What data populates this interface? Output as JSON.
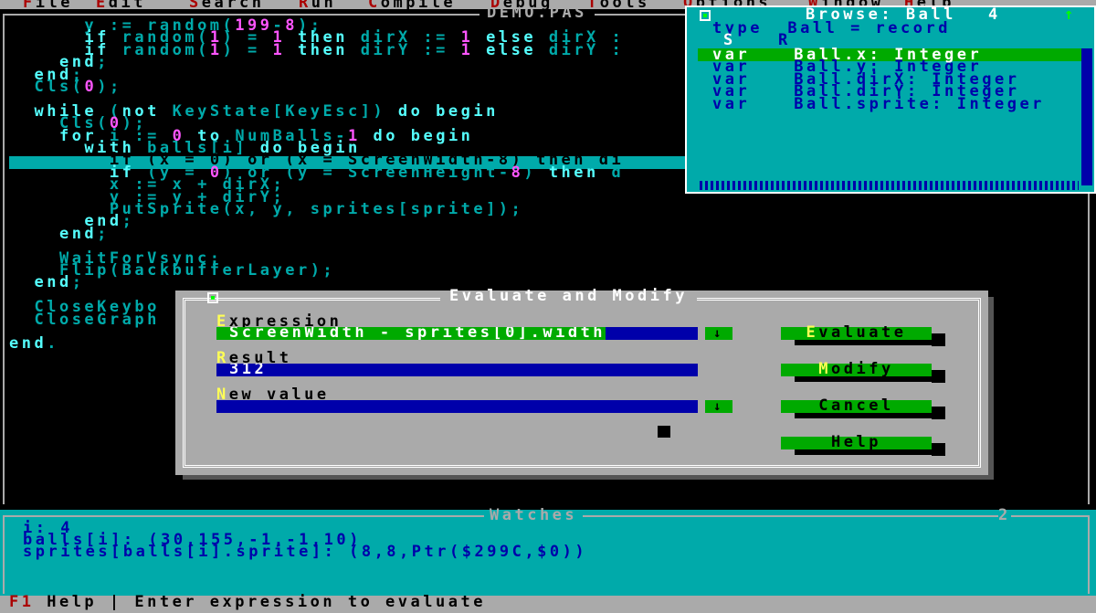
{
  "menubar": {
    "items": [
      {
        "hot": "F",
        "rest": "ile"
      },
      {
        "hot": "E",
        "rest": "dit"
      },
      {
        "hot": "S",
        "rest": "earch"
      },
      {
        "hot": "R",
        "rest": "un"
      },
      {
        "hot": "C",
        "rest": "ompile"
      },
      {
        "hot": "D",
        "rest": "ebug"
      },
      {
        "hot": "T",
        "rest": "ools"
      },
      {
        "hot": "O",
        "rest": "ptions"
      },
      {
        "hot": "W",
        "rest": "indow"
      },
      {
        "hot": "H",
        "rest": "elp"
      }
    ]
  },
  "editor": {
    "title": "DEMO.PAS",
    "lines": [
      "      y := random(199-8);",
      "      if random(1) = 1 then dirX := 1 else dirX :",
      "      if random(1) = 1 then dirY := 1 else dirY :",
      "    end;",
      "  end;",
      "  Cls(0);",
      "",
      "  while (not KeyState[KeyEsc]) do begin",
      "    Cls(0);",
      "    for i := 0 to NumBalls-1 do begin",
      "      with balls[i] do begin",
      "        if (x = 0) or (x = ScreenWidth-8) then di",
      "        if (y = 0) or (y = ScreenHeight-8) then d",
      "        x := x + dirX;",
      "        y := y + dirY;",
      "        PutSprite(x, y, sprites[sprite]);",
      "      end;",
      "    end;",
      "",
      "    WaitForVsync;",
      "    Flip(BackbufferLayer);",
      "  end;",
      "",
      "  CloseKeybo",
      "  CloseGraph",
      "",
      "end."
    ]
  },
  "browse": {
    "title": "Browse: Ball",
    "window_number": "4",
    "type_line": "type  Ball = record",
    "tabs": [
      "S",
      "R"
    ],
    "rows": [
      {
        "kind": "var",
        "text": "Ball.x: Integer"
      },
      {
        "kind": "var",
        "text": "Ball.y: Integer"
      },
      {
        "kind": "var",
        "text": "Ball.dirX: Integer"
      },
      {
        "kind": "var",
        "text": "Ball.dirY: Integer"
      },
      {
        "kind": "var",
        "text": "Ball.sprite: Integer"
      }
    ]
  },
  "dialog": {
    "title": "Evaluate and Modify",
    "expression_label": {
      "hot": "E",
      "rest": "xpression"
    },
    "expression_value": "ScreenWidth - sprites[0].width",
    "result_label": {
      "hot": "R",
      "rest": "esult"
    },
    "result_value": "312",
    "newvalue_label": {
      "hot": "N",
      "rest": "ew value"
    },
    "newvalue_value": "",
    "dropdown_glyph": "↓",
    "buttons": [
      {
        "pre": "",
        "hot": "E",
        "post": "valuate"
      },
      {
        "pre": "",
        "hot": "M",
        "post": "odify"
      },
      {
        "pre": "",
        "hot": "",
        "post": "Cancel"
      },
      {
        "pre": "",
        "hot": "",
        "post": "Help"
      }
    ]
  },
  "watches": {
    "title": "Watches",
    "window_number": "2",
    "lines": [
      "i: 4",
      "balls[i]: (30,155,-1,-1,10)",
      "sprites[balls[i].sprite]: (8,8,Ptr($299C,$0))"
    ]
  },
  "status": {
    "hot": "F1",
    "rest": " Help | Enter expression to evaluate"
  },
  "colors": {
    "background": "#000000",
    "code": "#00aaaa",
    "numbers": "#ff55ff",
    "panel": "#aaaaaa",
    "cyan_window": "#00aaaa",
    "field": "#0000aa",
    "button": "#00aa00",
    "hotkey_red": "#aa0000",
    "hotkey_yellow": "#ffff55"
  }
}
